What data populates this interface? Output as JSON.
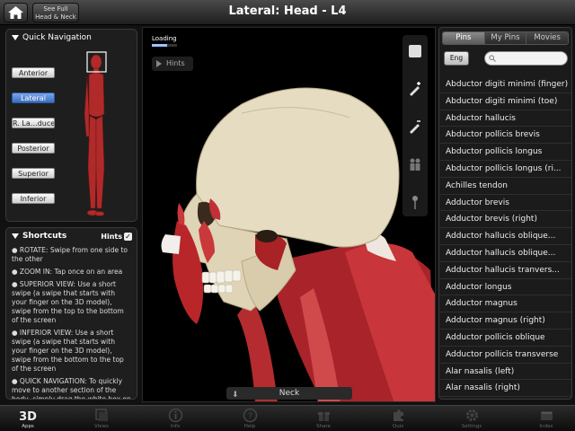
{
  "header": {
    "title": "Lateral: Head - L4",
    "see_full_line1": "See Full",
    "see_full_line2": "Head & Neck"
  },
  "quick_nav": {
    "title": "Quick Navigation",
    "buttons": [
      "Anterior",
      "Lateral",
      "R. La…duce",
      "Posterior",
      "Superior",
      "Inferior"
    ],
    "active": "Lateral"
  },
  "shortcuts": {
    "title": "Shortcuts",
    "hints_label": "Hints",
    "hints_checked": "✓",
    "items": [
      "● ROTATE: Swipe from one side to the other",
      "● ZOOM IN: Tap once on an area",
      "● SUPERIOR VIEW: Use a short swipe (a swipe that starts with your finger on the 3D model), swipe from the top to the bottom of the screen",
      "● INFERIOR VIEW: Use a short swipe (a swipe that starts with your finger on the 3D model), swipe from the bottom to the top of the screen",
      "● QUICK NAVIGATION: To quickly move to another section of the body, simply drag the white box on the"
    ]
  },
  "viewport": {
    "loading_label": "Loading",
    "loading_progress": 0.6,
    "hints_button": "Hints",
    "region_label": "Neck"
  },
  "right_panel": {
    "tabs": [
      "Pins",
      "My Pins",
      "Movies"
    ],
    "active_tab": "Pins",
    "language_button": "Eng",
    "search_placeholder": "",
    "items": [
      "Abductor digiti minimi (finger)",
      "Abductor digiti minimi (toe)",
      "Abductor hallucis",
      "Abductor pollicis brevis",
      "Abductor pollicis longus",
      "Abductor pollicis longus (ri...",
      "Achilles tendon",
      "Adductor brevis",
      "Adductor brevis (right)",
      "Adductor hallucis oblique...",
      "Adductor hallucis oblique...",
      "Adductor hallucis tranvers...",
      "Adductor longus",
      "Adductor magnus",
      "Adductor magnus (right)",
      "Adductor pollicis oblique",
      "Adductor pollicis transverse",
      "Alar nasalis (left)",
      "Alar nasalis (right)"
    ]
  },
  "tabbar": {
    "items": [
      "Apps",
      "Views",
      "Info",
      "Help",
      "Share",
      "Quiz",
      "Settings",
      "Index"
    ],
    "active": "Apps"
  },
  "colors": {
    "accent_blue": "#3b6fc4",
    "muscle_red": "#b8262a",
    "bone": "#e6dcc2"
  }
}
